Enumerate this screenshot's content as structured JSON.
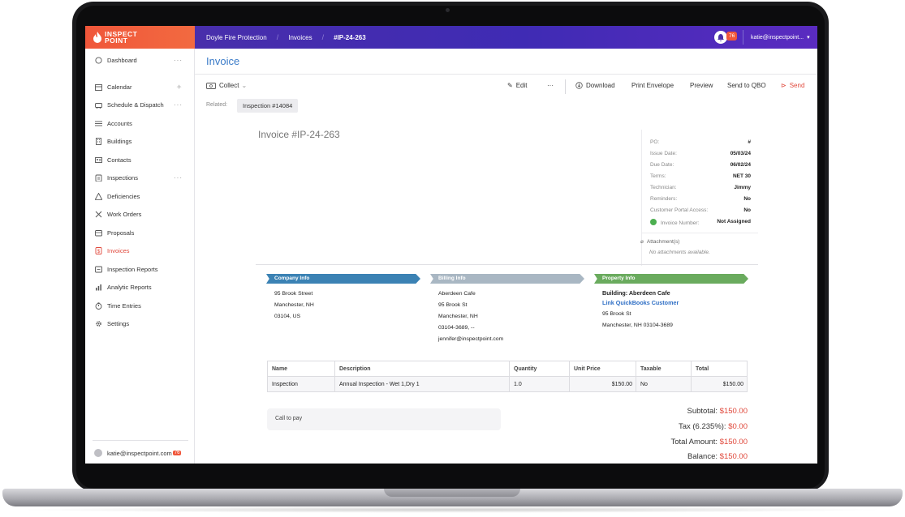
{
  "app": {
    "logo_line1": "INSPECT",
    "logo_line2": "POINT",
    "breadcrumb": [
      "Doyle Fire Protection",
      "Invoices",
      "#IP-24-263"
    ],
    "notification_count": "76",
    "user_email_truncated": "katie@inspectpoint..."
  },
  "sidebar": {
    "items": [
      {
        "label": "Dashboard",
        "icon": "circle-icon",
        "more": "···"
      },
      {
        "label": "Calendar",
        "icon": "calendar-icon",
        "more": "sparkle"
      },
      {
        "label": "Schedule & Dispatch",
        "icon": "dispatch-icon",
        "more": "···"
      },
      {
        "label": "Accounts",
        "icon": "list-icon"
      },
      {
        "label": "Buildings",
        "icon": "building-icon"
      },
      {
        "label": "Contacts",
        "icon": "contacts-icon"
      },
      {
        "label": "Inspections",
        "icon": "clipboard-icon",
        "more": "···"
      },
      {
        "label": "Deficiencies",
        "icon": "warning-icon"
      },
      {
        "label": "Work Orders",
        "icon": "wrench-icon"
      },
      {
        "label": "Proposals",
        "icon": "proposal-icon"
      },
      {
        "label": "Invoices",
        "icon": "dollar-file-icon",
        "active": true
      },
      {
        "label": "Inspection Reports",
        "icon": "report-icon"
      },
      {
        "label": "Analytic Reports",
        "icon": "bar-chart-icon"
      },
      {
        "label": "Time Entries",
        "icon": "stopwatch-icon"
      },
      {
        "label": "Settings",
        "icon": "gear-icon"
      }
    ],
    "user_email": "katie@inspectpoint.com",
    "user_badge": "76"
  },
  "page": {
    "title": "Invoice",
    "collect_label": "Collect",
    "actions": {
      "edit": "Edit",
      "more": "···",
      "download": "Download",
      "print_envelope": "Print Envelope",
      "preview": "Preview",
      "send_qbo": "Send to QBO",
      "send": "Send"
    },
    "related_label": "Related:",
    "related_chip": "Inspection #14084"
  },
  "invoice": {
    "heading": "Invoice #IP-24-263",
    "meta": [
      {
        "k": "PO:",
        "v": "#"
      },
      {
        "k": "Issue Date:",
        "v": "05/03/24"
      },
      {
        "k": "Due Date:",
        "v": "06/02/24"
      },
      {
        "k": "Terms:",
        "v": "NET 30"
      },
      {
        "k": "Technician:",
        "v": "Jimmy"
      },
      {
        "k": "Reminders:",
        "v": "No"
      },
      {
        "k": "Customer Portal Access:",
        "v": "No"
      },
      {
        "k": "Invoice Number:",
        "v": "Not Assigned"
      }
    ],
    "attachments_label": "Attachment(s)",
    "attachments_empty": "No attachments available.",
    "company": {
      "header": "Company Info",
      "lines": [
        "95 Brook Street",
        "Manchester, NH",
        "03104, US"
      ]
    },
    "billing": {
      "header": "Billing Info",
      "lines": [
        "Aberdeen Cafe",
        "95 Brook St",
        "Manchester, NH",
        "03104-3689, --",
        "jennifer@inspectpoint.com"
      ]
    },
    "property": {
      "header": "Property Info",
      "building": "Building: Aberdeen Cafe",
      "link": "Link QuickBooks Customer",
      "lines": [
        "95 Brook St",
        "Manchester, NH 03104-3689"
      ]
    },
    "table": {
      "columns": [
        "Name",
        "Description",
        "Quantity",
        "Unit Price",
        "Taxable",
        "Total"
      ],
      "rows": [
        [
          "Inspection",
          "Annual Inspection - Wet 1,Dry 1",
          "1.0",
          "$150.00",
          "No",
          "$150.00"
        ]
      ]
    },
    "note": "Call to pay",
    "totals": {
      "subtotal_label": "Subtotal:",
      "subtotal": "$150.00",
      "tax_label": "Tax (6.235%):",
      "tax": "$0.00",
      "total_label": "Total Amount:",
      "total": "$150.00",
      "balance_label": "Balance:",
      "balance": "$150.00"
    }
  },
  "colors": {
    "topbar": "#4b2fa8",
    "logo_bg": "#f0563a",
    "accent_blue": "#3a7bc8",
    "company_banner": "#3b82b4",
    "billing_banner": "#a9b7c3",
    "property_banner": "#6aab5e",
    "amount_red": "#e0493c"
  }
}
